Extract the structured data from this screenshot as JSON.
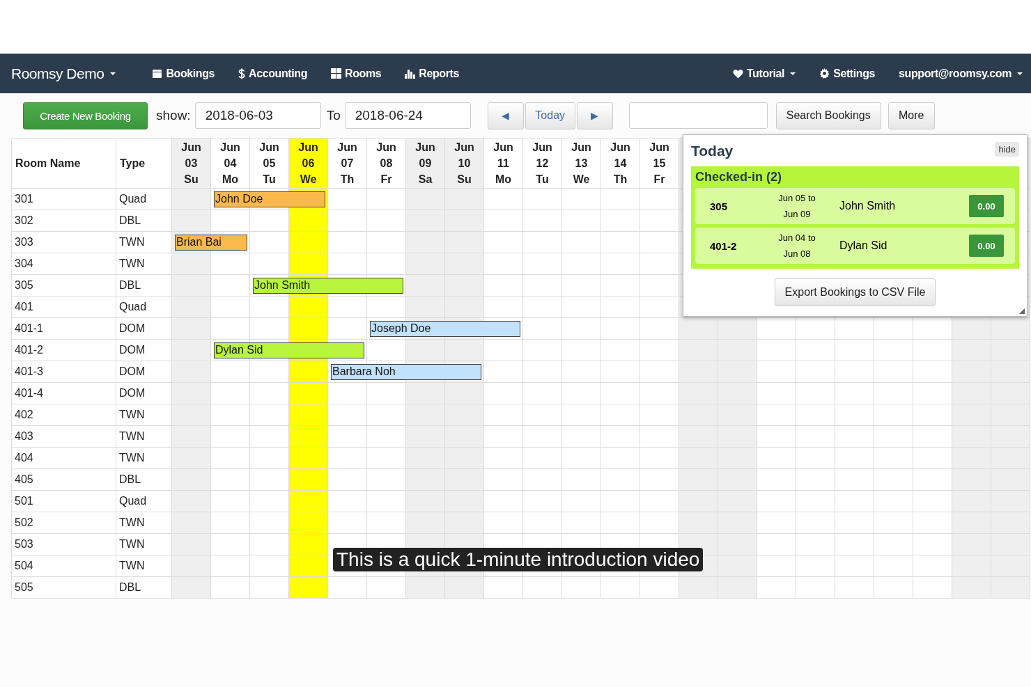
{
  "navbar": {
    "brand": "Roomsy Demo",
    "items": [
      {
        "label": "Bookings"
      },
      {
        "label": "Accounting"
      },
      {
        "label": "Rooms"
      },
      {
        "label": "Reports"
      }
    ],
    "right": [
      {
        "label": "Tutorial",
        "dropdown": true
      },
      {
        "label": "Settings",
        "dropdown": false
      },
      {
        "label": "support@roomsy.com",
        "dropdown": true
      }
    ]
  },
  "toolbar": {
    "create": "Create New Booking",
    "show_label": "show:",
    "from": "2018-06-03",
    "to_label": "To",
    "to": "2018-06-24",
    "prev": "◀",
    "today": "Today",
    "next": "▶",
    "search_button": "Search Bookings",
    "more": "More"
  },
  "grid": {
    "columns": [
      "Room Name",
      "Type"
    ],
    "days": [
      {
        "month": "Jun",
        "date": "03",
        "weekday": "Su",
        "weekend": true,
        "today": false
      },
      {
        "month": "Jun",
        "date": "04",
        "weekday": "Mo",
        "weekend": false,
        "today": false
      },
      {
        "month": "Jun",
        "date": "05",
        "weekday": "Tu",
        "weekend": false,
        "today": false
      },
      {
        "month": "Jun",
        "date": "06",
        "weekday": "We",
        "weekend": false,
        "today": true
      },
      {
        "month": "Jun",
        "date": "07",
        "weekday": "Th",
        "weekend": false,
        "today": false
      },
      {
        "month": "Jun",
        "date": "08",
        "weekday": "Fr",
        "weekend": false,
        "today": false
      },
      {
        "month": "Jun",
        "date": "09",
        "weekday": "Sa",
        "weekend": true,
        "today": false
      },
      {
        "month": "Jun",
        "date": "10",
        "weekday": "Su",
        "weekend": true,
        "today": false
      },
      {
        "month": "Jun",
        "date": "11",
        "weekday": "Mo",
        "weekend": false,
        "today": false
      },
      {
        "month": "Jun",
        "date": "12",
        "weekday": "Tu",
        "weekend": false,
        "today": false
      },
      {
        "month": "Jun",
        "date": "13",
        "weekday": "We",
        "weekend": false,
        "today": false
      },
      {
        "month": "Jun",
        "date": "14",
        "weekday": "Th",
        "weekend": false,
        "today": false
      },
      {
        "month": "Jun",
        "date": "15",
        "weekday": "Fr",
        "weekend": false,
        "today": false
      },
      {
        "weekend": true,
        "today": false
      },
      {
        "weekend": true,
        "today": false
      },
      {
        "weekend": false,
        "today": false
      },
      {
        "weekend": false,
        "today": false
      },
      {
        "weekend": false,
        "today": false
      },
      {
        "weekend": false,
        "today": false
      },
      {
        "weekend": false,
        "today": false
      },
      {
        "weekend": true,
        "today": false
      },
      {
        "weekend": true,
        "today": false
      }
    ],
    "rooms": [
      {
        "name": "301",
        "type": "Quad",
        "cells": [
          {
            "kind": "free"
          },
          {
            "kind": "start",
            "guest": "John Doe",
            "color": "#fbb94c"
          },
          {
            "kind": "stay"
          },
          {
            "kind": "stay"
          }
        ]
      },
      {
        "name": "302",
        "type": "DBL"
      },
      {
        "name": "303",
        "type": "TWN",
        "cells": [
          {
            "kind": "start",
            "guest": "Brian Bai",
            "color": "#fbb94c"
          },
          {
            "kind": "stay"
          }
        ]
      },
      {
        "name": "304",
        "type": "TWN"
      },
      {
        "name": "305",
        "type": "DBL",
        "cells": [
          {
            "kind": "free"
          },
          {
            "kind": "free"
          },
          {
            "kind": "start",
            "guest": "John Smith",
            "color": "#b8f53c"
          },
          {
            "kind": "stay"
          },
          {
            "kind": "stay"
          },
          {
            "kind": "stay"
          }
        ]
      },
      {
        "name": "401",
        "type": "Quad"
      },
      {
        "name": "401-1",
        "type": "DOM",
        "cells": [
          {
            "kind": "free"
          },
          {
            "kind": "free"
          },
          {
            "kind": "free"
          },
          {
            "kind": "free"
          },
          {
            "kind": "free"
          },
          {
            "kind": "start",
            "guest": "Joseph Doe",
            "color": "#c2e1fb"
          },
          {
            "kind": "stay"
          },
          {
            "kind": "stay"
          },
          {
            "kind": "stay"
          }
        ]
      },
      {
        "name": "401-2",
        "type": "DOM",
        "cells": [
          {
            "kind": "free"
          },
          {
            "kind": "start",
            "guest": "Dylan Sid",
            "color": "#b8f53c"
          },
          {
            "kind": "stay"
          },
          {
            "kind": "stay"
          },
          {
            "kind": "stay"
          }
        ]
      },
      {
        "name": "401-3",
        "type": "DOM",
        "cells": [
          {
            "kind": "free"
          },
          {
            "kind": "free"
          },
          {
            "kind": "free"
          },
          {
            "kind": "free"
          },
          {
            "kind": "start",
            "guest": "Barbara Noh",
            "color": "#c2e1fb"
          },
          {
            "kind": "stay"
          },
          {
            "kind": "stay"
          },
          {
            "kind": "stay"
          }
        ]
      },
      {
        "name": "401-4",
        "type": "DOM"
      },
      {
        "name": "402",
        "type": "TWN"
      },
      {
        "name": "403",
        "type": "TWN"
      },
      {
        "name": "404",
        "type": "TWN"
      },
      {
        "name": "405",
        "type": "DBL"
      },
      {
        "name": "501",
        "type": "Quad"
      },
      {
        "name": "502",
        "type": "TWN"
      },
      {
        "name": "503",
        "type": "TWN"
      },
      {
        "name": "504",
        "type": "TWN"
      },
      {
        "name": "505",
        "type": "DBL"
      }
    ]
  },
  "today_panel": {
    "title": "Today",
    "hide": "hide",
    "section": "Checked-in (2)",
    "entries": [
      {
        "room": "305",
        "from": "Jun 05 to",
        "to": "Jun 09",
        "guest": "John Smith",
        "amount": "0.00"
      },
      {
        "room": "401-2",
        "from": "Jun 04 to",
        "to": "Jun 08",
        "guest": "Dylan Sid",
        "amount": "0.00"
      }
    ],
    "export": "Export Bookings to CSV File"
  },
  "caption": "This is a quick 1-minute introduction video"
}
